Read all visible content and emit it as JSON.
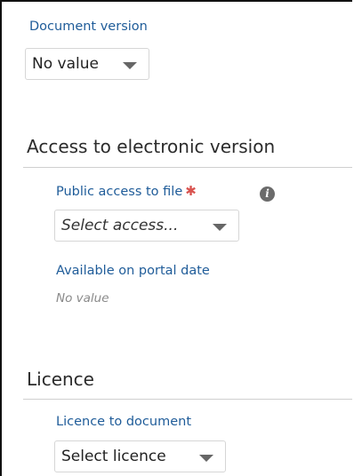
{
  "document_version": {
    "label": "Document version",
    "value": "No value"
  },
  "access_section": {
    "title": "Access to electronic version",
    "public_access": {
      "label": "Public access to file",
      "required_mark": "✱",
      "placeholder": "Select access...",
      "info_glyph": "i"
    },
    "portal_date": {
      "label": "Available on portal date",
      "value": "No value"
    }
  },
  "licence_section": {
    "title": "Licence",
    "licence_to_document": {
      "label": "Licence to document",
      "value": "Select licence"
    }
  },
  "icons": {
    "dropdown": "chevron-down-icon",
    "info": "info-icon",
    "required": "required-asterisk-icon"
  },
  "colors": {
    "label": "#1f5c99",
    "required": "#d9534f",
    "muted_value": "#8a8a8a"
  }
}
